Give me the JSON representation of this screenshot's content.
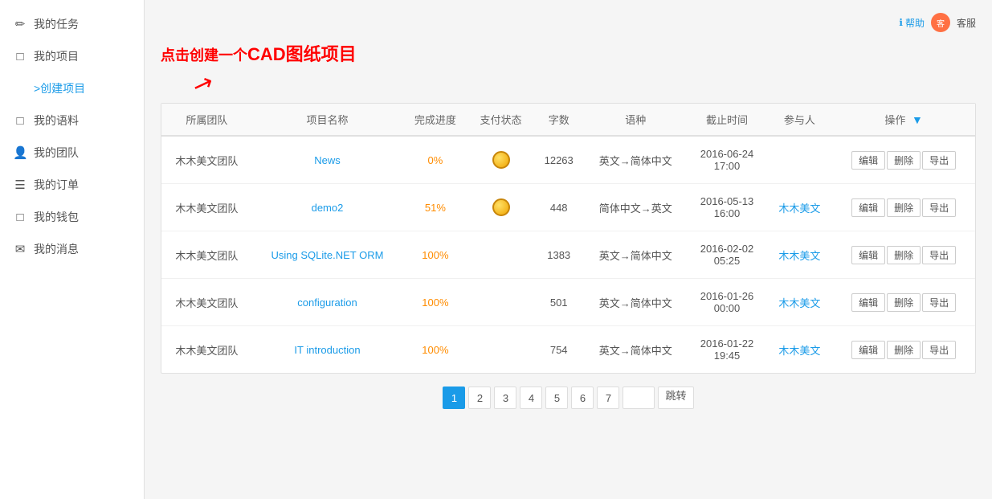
{
  "header": {
    "help_label": "帮助",
    "user_avatar_text": "客",
    "user_name": "客服"
  },
  "annotation": {
    "text_before": "点击创建一个",
    "text_bold": "CAD图纸项目",
    "text_after": ""
  },
  "sidebar": {
    "items": [
      {
        "id": "my-tasks",
        "label": "我的任务",
        "icon": "✏"
      },
      {
        "id": "my-projects",
        "label": "我的项目",
        "icon": "▢"
      },
      {
        "id": "create-project",
        "label": ">创建项目",
        "icon": ""
      },
      {
        "id": "my-vocab",
        "label": "我的语料",
        "icon": "▢"
      },
      {
        "id": "my-team",
        "label": "我的团队",
        "icon": "👤"
      },
      {
        "id": "my-orders",
        "label": "我的订单",
        "icon": "☰"
      },
      {
        "id": "my-wallet",
        "label": "我的钱包",
        "icon": "▢"
      },
      {
        "id": "my-messages",
        "label": "我的消息",
        "icon": "✉"
      }
    ]
  },
  "table": {
    "columns": [
      {
        "id": "team",
        "label": "所属团队"
      },
      {
        "id": "name",
        "label": "项目名称"
      },
      {
        "id": "progress",
        "label": "完成进度"
      },
      {
        "id": "payment",
        "label": "支付状态"
      },
      {
        "id": "words",
        "label": "字数"
      },
      {
        "id": "language",
        "label": "语种"
      },
      {
        "id": "deadline",
        "label": "截止时间"
      },
      {
        "id": "participant",
        "label": "参与人"
      },
      {
        "id": "actions",
        "label": "操作"
      }
    ],
    "rows": [
      {
        "team": "木木美文团队",
        "name": "News",
        "progress": "0%",
        "payment": "coin",
        "words": "12263",
        "language": "英文→简体中文",
        "deadline": "2016-06-24 17:00",
        "participant": "",
        "actions": [
          "编辑",
          "删除",
          "导出"
        ]
      },
      {
        "team": "木木美文团队",
        "name": "demo2",
        "progress": "51%",
        "payment": "coin",
        "words": "448",
        "language": "简体中文→英文",
        "deadline": "2016-05-13 16:00",
        "participant": "木木美文",
        "actions": [
          "编辑",
          "删除",
          "导出"
        ]
      },
      {
        "team": "木木美文团队",
        "name": "Using SQLite.NET ORM",
        "progress": "100%",
        "payment": "",
        "words": "1383",
        "language": "英文→简体中文",
        "deadline": "2016-02-02 05:25",
        "participant": "木木美文",
        "actions": [
          "编辑",
          "删除",
          "导出"
        ]
      },
      {
        "team": "木木美文团队",
        "name": "configuration",
        "progress": "100%",
        "payment": "",
        "words": "501",
        "language": "英文→简体中文",
        "deadline": "2016-01-26 00:00",
        "participant": "木木美文",
        "actions": [
          "编辑",
          "删除",
          "导出"
        ]
      },
      {
        "team": "木木美文团队",
        "name": "IT introduction",
        "progress": "100%",
        "payment": "",
        "words": "754",
        "language": "英文→简体中文",
        "deadline": "2016-01-22 19:45",
        "participant": "木木美文",
        "actions": [
          "编辑",
          "删除",
          "导出"
        ]
      }
    ]
  },
  "pagination": {
    "pages": [
      "1",
      "2",
      "3",
      "4",
      "5",
      "6",
      "7"
    ],
    "current": "1",
    "jump_label": "跳转"
  }
}
